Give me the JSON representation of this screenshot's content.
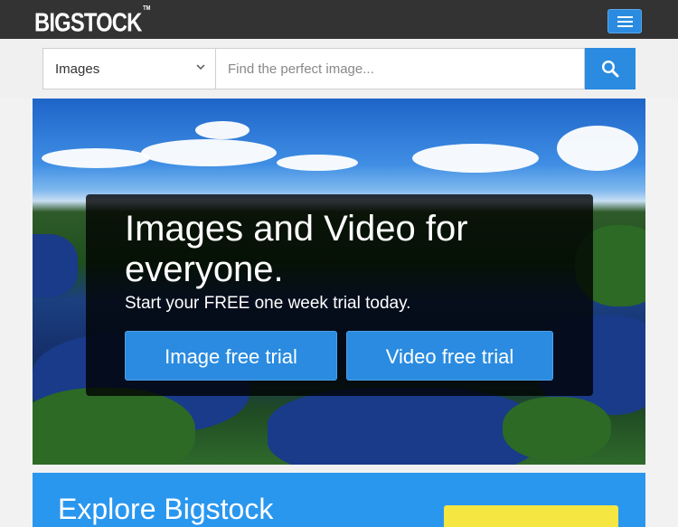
{
  "header": {
    "logo_text": "BIGSTOCK",
    "logo_tm": "TM",
    "menu_icon": "hamburger-icon"
  },
  "search": {
    "type_selected": "Images",
    "placeholder": "Find the perfect image...",
    "search_icon": "search-icon"
  },
  "hero": {
    "headline": "Images and Video for everyone.",
    "subhead": "Start your FREE one week trial today.",
    "image_trial_label": "Image free trial",
    "video_trial_label": "Video free trial"
  },
  "explore": {
    "title": "Explore Bigstock"
  },
  "colors": {
    "accent_blue": "#2a8be0",
    "topbar": "#333333",
    "cta_yellow": "#f5e642"
  }
}
